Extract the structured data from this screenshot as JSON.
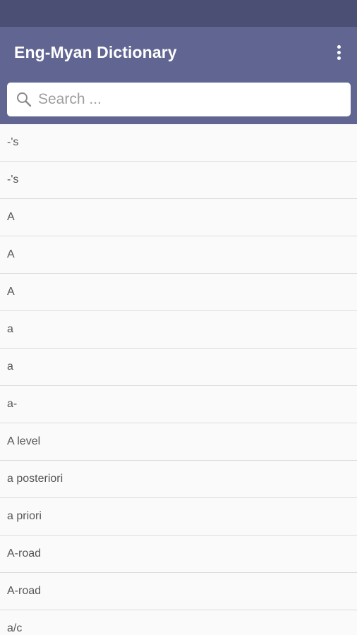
{
  "app_bar": {
    "title": "Eng-Myan Dictionary",
    "menu_icon": "more-vert-icon"
  },
  "search": {
    "icon": "search-icon",
    "placeholder": "Search ...",
    "value": ""
  },
  "words": [
    "-'s",
    "-'s",
    "A",
    "A",
    "A",
    "a",
    "a",
    "a-",
    "A level",
    "a posteriori",
    "a priori",
    "A-road",
    "A-road",
    "a/c"
  ],
  "colors": {
    "status_bar": "#4b4f73",
    "app_bar": "#616591",
    "list_background": "#fafafa",
    "divider": "#dcdcdc"
  }
}
